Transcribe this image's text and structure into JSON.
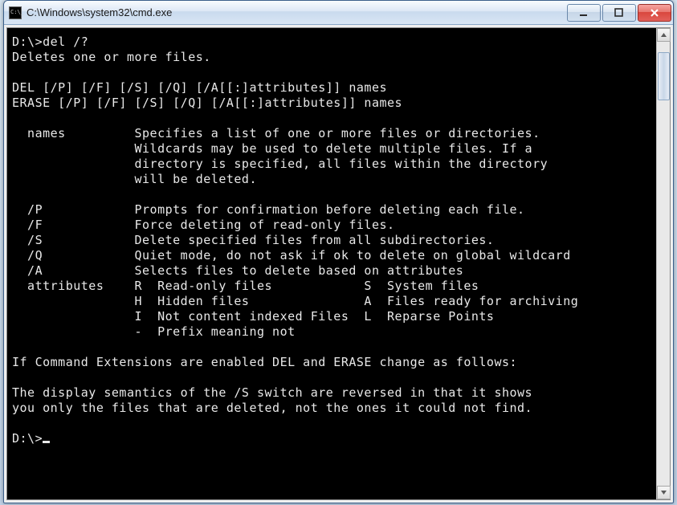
{
  "window": {
    "title": "C:\\Windows\\system32\\cmd.exe"
  },
  "terminal": {
    "prompt1": "D:\\>",
    "command1": "del /?",
    "out1": "Deletes one or more files.",
    "blank": "",
    "syntax1": "DEL [/P] [/F] [/S] [/Q] [/A[[:]attributes]] names",
    "syntax2": "ERASE [/P] [/F] [/S] [/Q] [/A[[:]attributes]] names",
    "names1": "  names         Specifies a list of one or more files or directories.",
    "names2": "                Wildcards may be used to delete multiple files. If a",
    "names3": "                directory is specified, all files within the directory",
    "names4": "                will be deleted.",
    "optP": "  /P            Prompts for confirmation before deleting each file.",
    "optF": "  /F            Force deleting of read-only files.",
    "optS": "  /S            Delete specified files from all subdirectories.",
    "optQ": "  /Q            Quiet mode, do not ask if ok to delete on global wildcard",
    "optA": "  /A            Selects files to delete based on attributes",
    "attr1": "  attributes    R  Read-only files            S  System files",
    "attr2": "                H  Hidden files               A  Files ready for archiving",
    "attr3": "                I  Not content indexed Files  L  Reparse Points",
    "attr4": "                -  Prefix meaning not",
    "ext1": "If Command Extensions are enabled DEL and ERASE change as follows:",
    "sem1": "The display semantics of the /S switch are reversed in that it shows",
    "sem2": "you only the files that are deleted, not the ones it could not find.",
    "prompt2": "D:\\>"
  }
}
